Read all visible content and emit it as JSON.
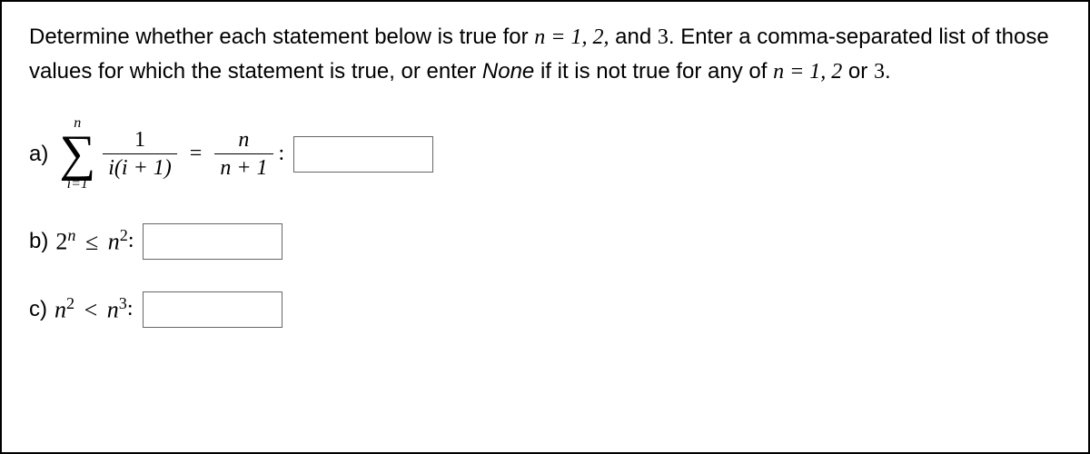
{
  "instructions": {
    "part1": "Determine whether each statement below is true for ",
    "n_eq": "n = 1, 2,",
    "part2": " and ",
    "three": "3",
    "part3": ". Enter a comma-separated list of those values for which the statement is true, or enter ",
    "none_word": "None",
    "part4": " if it is not true for any of ",
    "n_eq2": "n = 1, 2",
    "or_word": " or ",
    "three2": "3",
    "period": "."
  },
  "problem_a": {
    "label": "a)",
    "sum_top": "n",
    "sum_bot": "i=1",
    "frac_num": "1",
    "frac_den": "i(i + 1)",
    "eq": "=",
    "rhs_num": "n",
    "rhs_den": "n + 1",
    "colon": ":",
    "answer": ""
  },
  "problem_b": {
    "label": "b)",
    "base1": "2",
    "exp1": "n",
    "op": "≤",
    "base2": "n",
    "exp2": "2",
    "colon": ":",
    "answer": ""
  },
  "problem_c": {
    "label": "c)",
    "base1": "n",
    "exp1": "2",
    "op": "<",
    "base2": "n",
    "exp2": "3",
    "colon": ":",
    "answer": ""
  }
}
